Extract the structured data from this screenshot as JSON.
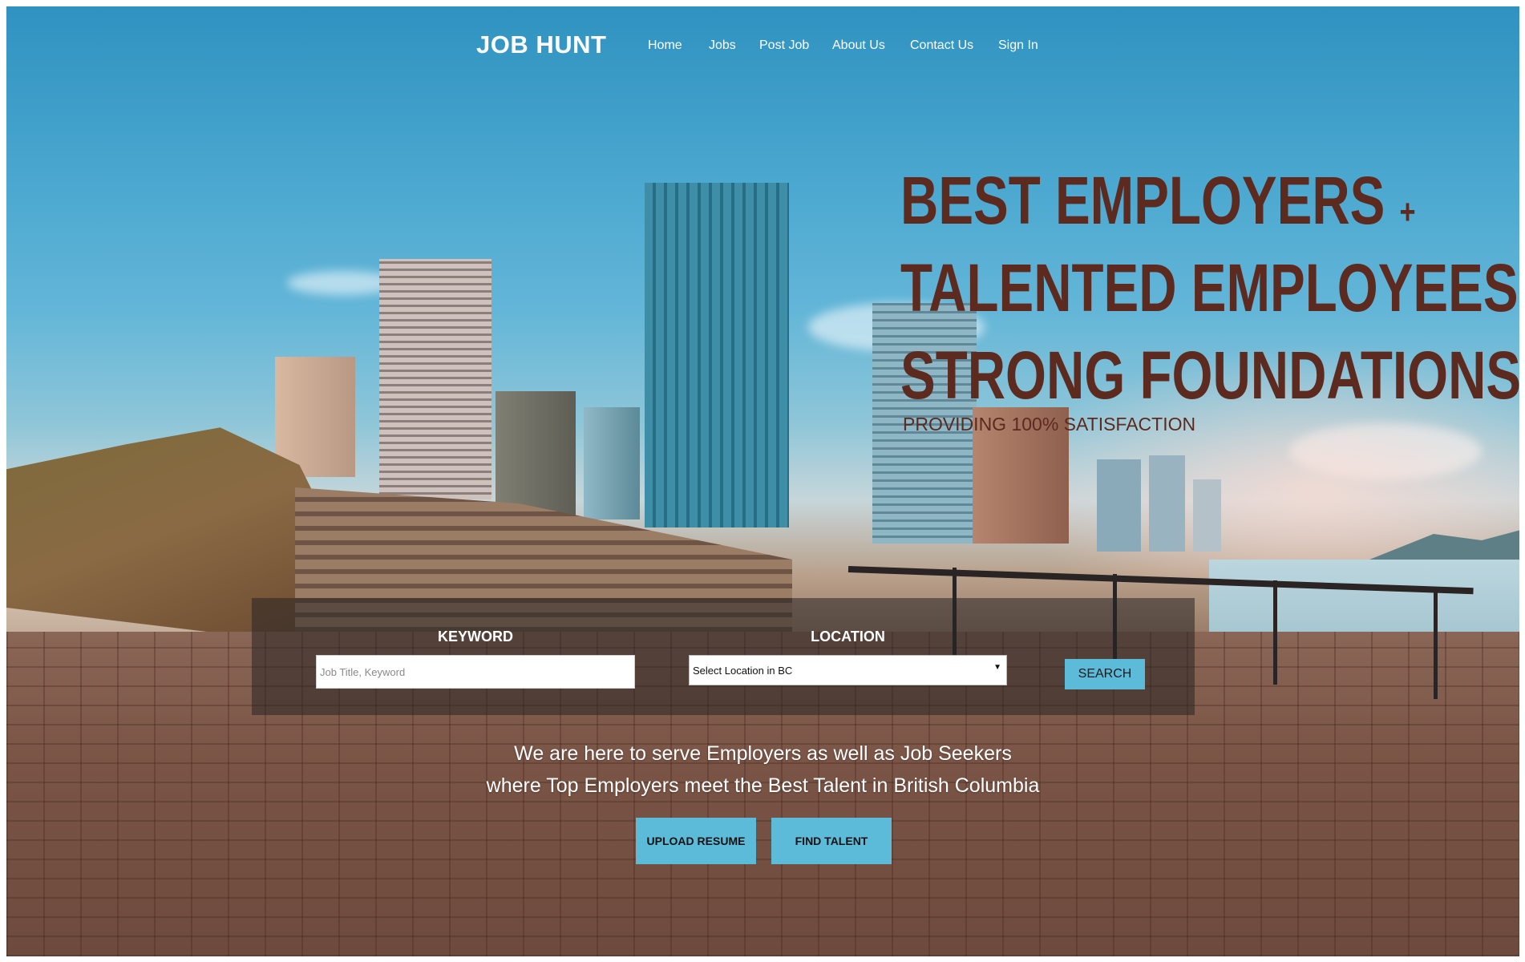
{
  "navbar": {
    "brand": "JOB HUNT",
    "items": [
      {
        "label": "Home"
      },
      {
        "label": "Jobs"
      },
      {
        "label": "Post Job"
      },
      {
        "label": "About Us"
      },
      {
        "label": "Contact Us"
      },
      {
        "label": "Sign In"
      }
    ]
  },
  "hero": {
    "headline": [
      {
        "text": "BEST EMPLOYERS",
        "sign": "+"
      },
      {
        "text": "TALENTED EMPLOYEES",
        "sign": "="
      },
      {
        "text": "STRONG FOUNDATIONS",
        "sign": ""
      }
    ],
    "tagline": "PROVIDING 100% SATISFACTION"
  },
  "search": {
    "keyword_label": "KEYWORD",
    "keyword_placeholder": "Job Title, Keyword",
    "location_label": "LOCATION",
    "location_value": "Select Location in BC",
    "button_label": "SEARCH"
  },
  "intro": {
    "line1": "We are here to serve Employers as well as Job Seekers",
    "line2": "where Top Employers meet the Best Talent in British Columbia"
  },
  "cta": {
    "upload_label": "UPLOAD RESUME",
    "find_label": "FIND TALENT"
  },
  "colors": {
    "accent": "#5bbbd8",
    "headline": "#5c2a1f",
    "nav_text": "#ffffff"
  },
  "icons": {
    "location_caret": "caret-down-icon"
  }
}
